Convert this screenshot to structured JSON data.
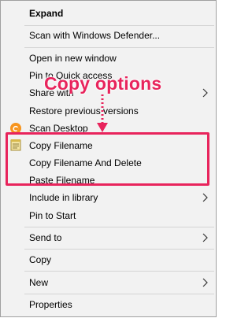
{
  "menu": {
    "expand": "Expand",
    "scan_defender": "Scan with Windows Defender...",
    "open_new_window": "Open in new window",
    "pin_quick_access": "Pin to Quick access",
    "share_with": "Share with",
    "restore_versions": "Restore previous versions",
    "scan_desktop": "Scan Desktop",
    "copy_filename": "Copy Filename",
    "copy_filename_delete": "Copy Filename And Delete",
    "paste_filename": "Paste Filename",
    "include_library": "Include in library",
    "pin_start": "Pin to Start",
    "send_to": "Send to",
    "copy": "Copy",
    "new": "New",
    "properties": "Properties"
  },
  "annotation": {
    "label": "Copy options",
    "color": "#e8245c"
  },
  "icons": {
    "scan_desktop": "avast-icon",
    "copy_filename": "notepad-icon",
    "submenu": "chevron-right-icon"
  }
}
